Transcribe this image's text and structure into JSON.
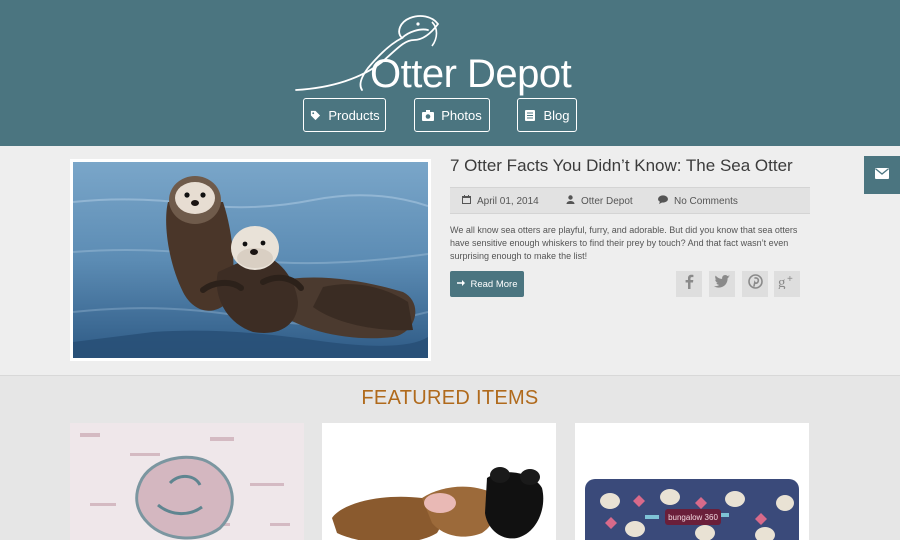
{
  "brand": {
    "name": "Otter Depot",
    "header_color": "#4b7580",
    "accent_color": "#b06a1c"
  },
  "nav": [
    {
      "label": "Products",
      "icon": "tag-icon"
    },
    {
      "label": "Photos",
      "icon": "camera-icon"
    },
    {
      "label": "Blog",
      "icon": "blog-icon"
    }
  ],
  "sidebar": {
    "contact_icon": "envelope-icon"
  },
  "post": {
    "title": "7 Otter Facts You Didn’t Know: The Sea Otter",
    "date": "April 01, 2014",
    "author": "Otter Depot",
    "comments": "No Comments",
    "excerpt": "We all know sea otters are playful, furry, and adorable. But did you know that sea otters have sensitive enough whiskers to find their prey by touch? And that fact wasn’t even surprising enough to make the list!",
    "read_more": "Read More",
    "share_icons": [
      "facebook-icon",
      "twitter-icon",
      "pinterest-icon",
      "google-plus-icon"
    ]
  },
  "featured": {
    "title": "FEATURED ITEMS",
    "product_text": "bungalow 360"
  }
}
